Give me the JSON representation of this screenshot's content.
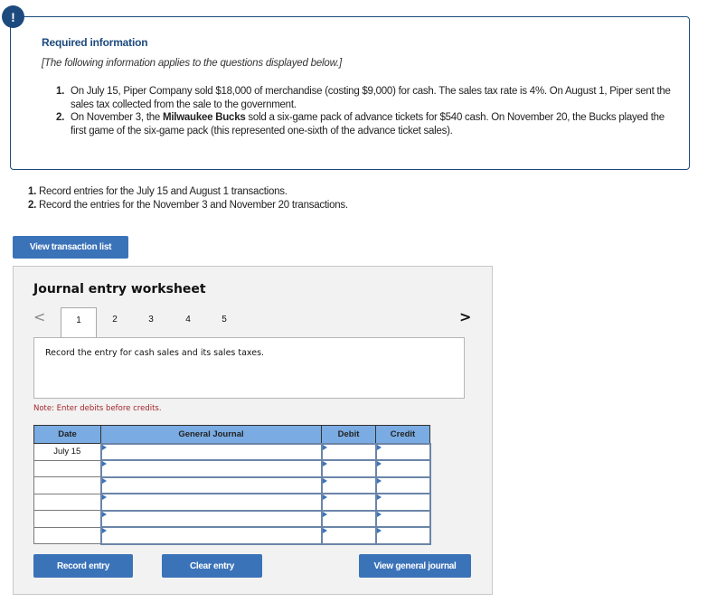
{
  "info": {
    "badge_icon": "!",
    "title": "Required information",
    "subtitle": "[The following information applies to the questions displayed below.]",
    "items": [
      {
        "num": "1.",
        "text_before": "On July 15, Piper Company sold $18,000 of merchandise (costing $9,000) for cash. The sales tax rate is 4%. On August 1, Piper sent the sales tax collected from the sale to the government.",
        "bold": "",
        "text_after": ""
      },
      {
        "num": "2.",
        "text_before": "On November 3, the ",
        "bold": "Milwaukee Bucks",
        "text_after": " sold a six-game pack of advance tickets for $540 cash. On November 20, the Bucks played the first game of the six-game pack (this represented one-sixth of the advance ticket sales)."
      }
    ]
  },
  "questions": [
    {
      "num": "1.",
      "text": "Record entries for the July 15 and August 1 transactions."
    },
    {
      "num": "2.",
      "text": "Record the entries for the November 3 and November 20 transactions."
    }
  ],
  "buttons": {
    "view_transaction_list": "View transaction list",
    "record_entry": "Record entry",
    "clear_entry": "Clear entry",
    "view_general_journal": "View general journal"
  },
  "worksheet": {
    "title": "Journal entry worksheet",
    "prev_icon": "<",
    "next_icon": ">",
    "tabs": [
      "1",
      "2",
      "3",
      "4",
      "5"
    ],
    "active_tab": "1",
    "prompt": "Record the entry for cash sales and its sales taxes.",
    "note": "Note: Enter debits before credits.",
    "table": {
      "headers": {
        "date": "Date",
        "journal": "General Journal",
        "debit": "Debit",
        "credit": "Credit"
      },
      "rows": [
        {
          "date": "July 15",
          "journal": "",
          "debit": "",
          "credit": ""
        },
        {
          "date": "",
          "journal": "",
          "debit": "",
          "credit": ""
        },
        {
          "date": "",
          "journal": "",
          "debit": "",
          "credit": ""
        },
        {
          "date": "",
          "journal": "",
          "debit": "",
          "credit": ""
        },
        {
          "date": "",
          "journal": "",
          "debit": "",
          "credit": ""
        },
        {
          "date": "",
          "journal": "",
          "debit": "",
          "credit": ""
        }
      ]
    }
  },
  "colors": {
    "brand_navy": "#1d4a7e",
    "button_blue": "#3b73b9",
    "table_header": "#7aabe2",
    "note_red": "#a3262b"
  }
}
